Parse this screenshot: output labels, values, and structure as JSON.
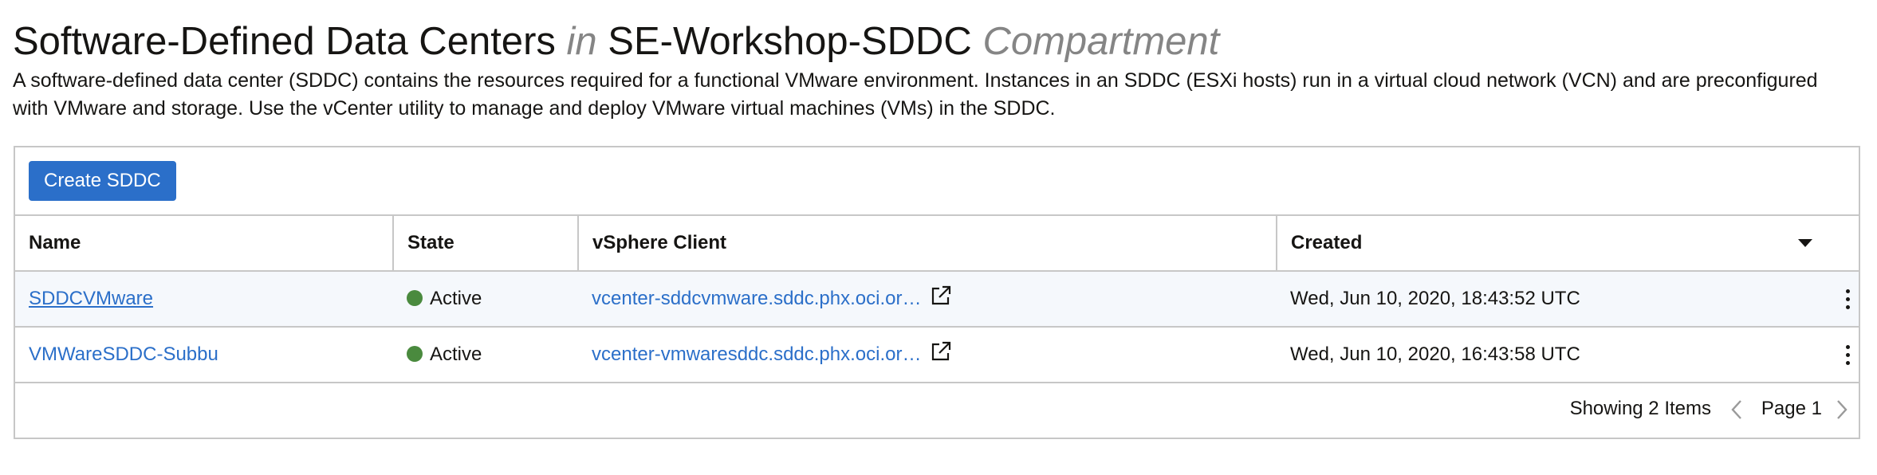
{
  "header": {
    "title": "Software-Defined Data Centers",
    "in_word": "in",
    "compartment_name": "SE-Workshop-SDDC",
    "compartment_word": "Compartment",
    "description": "A software-defined data center (SDDC) contains the resources required for a functional VMware environment. Instances in an SDDC (ESXi hosts) run in a virtual cloud network (VCN) and are preconfigured with VMware and storage. Use the vCenter utility to manage and deploy VMware virtual machines (VMs) in the SDDC."
  },
  "toolbar": {
    "create_label": "Create SDDC"
  },
  "table": {
    "columns": [
      "Name",
      "State",
      "vSphere Client",
      "Created"
    ],
    "rows": [
      {
        "name": "SDDCVMware",
        "state": "Active",
        "client": "vcenter-sddcvmware.sddc.phx.oci.or…",
        "created": "Wed, Jun 10, 2020, 18:43:52 UTC"
      },
      {
        "name": "VMWareSDDC-Subbu",
        "state": "Active",
        "client": "vcenter-vmwaresddc.sddc.phx.oci.or…",
        "created": "Wed, Jun 10, 2020, 16:43:58 UTC"
      }
    ]
  },
  "footer": {
    "showing": "Showing 2 Items",
    "page": "Page 1"
  },
  "icons": {
    "status": "status-dot-icon",
    "external": "external-link-icon",
    "actions": "kebab-menu-icon",
    "sort": "sort-down-icon",
    "prev": "chevron-left-icon",
    "next": "chevron-right-icon"
  },
  "colors": {
    "accent": "#2b6fc9",
    "status_active": "#4a8a3e",
    "muted_text": "#858585",
    "border": "#c7c7c7"
  }
}
